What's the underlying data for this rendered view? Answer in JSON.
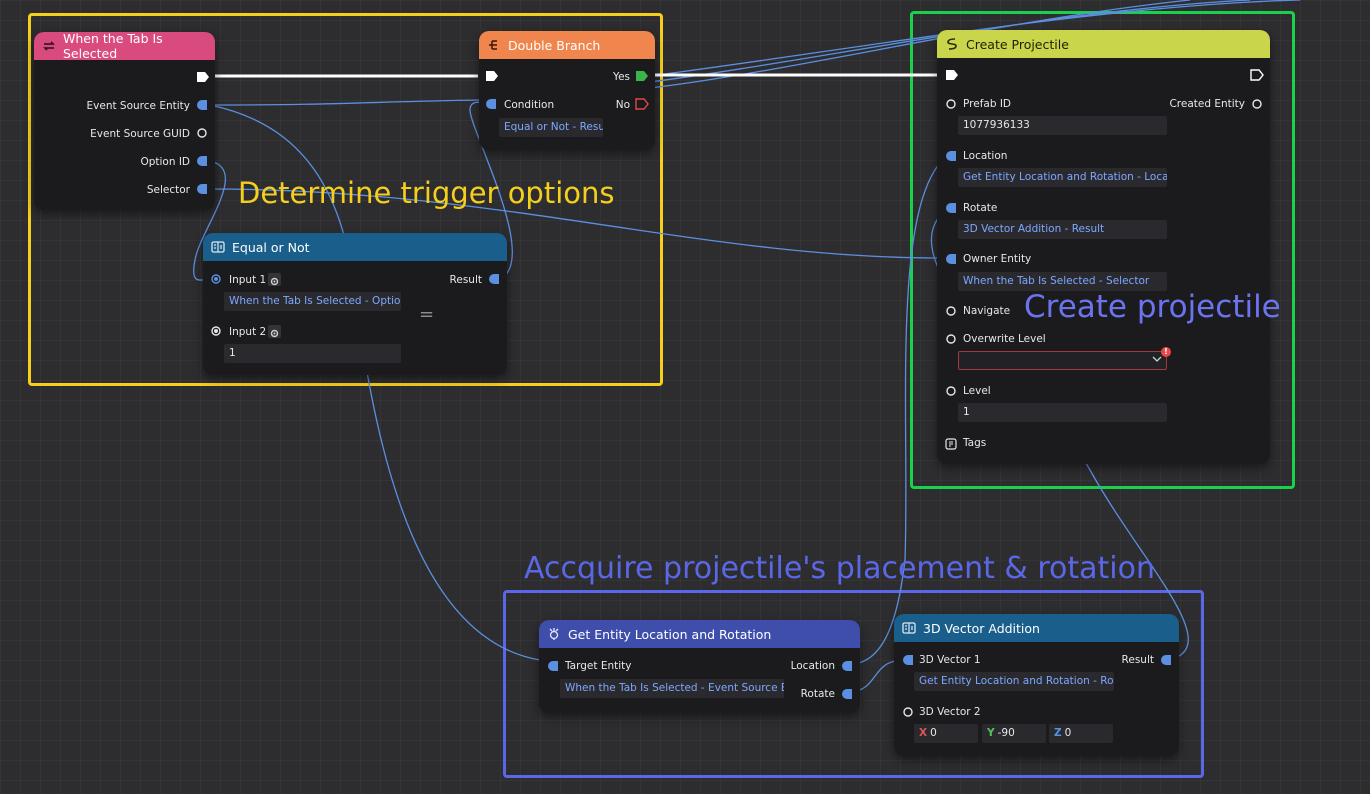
{
  "groups": {
    "trigger": "Determine trigger options",
    "create": "Create projectile",
    "placement": "Accquire projectile's placement & rotation"
  },
  "nodes": {
    "tab_selected": {
      "title": "When the Tab Is Selected",
      "outputs": [
        "Event Source Entity",
        "Event Source GUID",
        "Option ID",
        "Selector"
      ]
    },
    "double_branch": {
      "title": "Double Branch",
      "yes": "Yes",
      "no": "No",
      "condition": "Condition",
      "condition_value": "Equal or Not - Result"
    },
    "equal_or_not": {
      "title": "Equal or Not",
      "input1": "Input 1",
      "input1_value": "When the Tab Is Selected - Option ID",
      "input2": "Input 2",
      "input2_value": "1",
      "result": "Result",
      "operator": "="
    },
    "create_projectile": {
      "title": "Create Projectile",
      "prefab_id": "Prefab ID",
      "prefab_value": "1077936133",
      "created_entity": "Created Entity",
      "location": "Location",
      "location_value": "Get Entity Location and Rotation - Location",
      "rotate": "Rotate",
      "rotate_value": "3D Vector Addition - Result",
      "owner": "Owner Entity",
      "owner_value": "When the Tab Is Selected - Selector",
      "navigate": "Navigate",
      "overwrite_level": "Overwrite Level",
      "warning": "!",
      "level": "Level",
      "level_value": "1",
      "tags": "Tags"
    },
    "get_location": {
      "title": "Get Entity Location and Rotation",
      "target": "Target Entity",
      "target_value": "When the Tab Is Selected - Event Source Entity",
      "location": "Location",
      "rotate": "Rotate"
    },
    "vector_add": {
      "title": "3D Vector Addition",
      "v1": "3D Vector 1",
      "v1_value": "Get Entity Location and Rotation - Rotate",
      "v2": "3D Vector 2",
      "result": "Result",
      "x_label": "X",
      "x_value": "0",
      "y_label": "Y",
      "y_value": "-90",
      "z_label": "Z",
      "z_value": "0"
    }
  },
  "colors": {
    "header_tab_selected": "#d94b7e",
    "header_double_branch": "#f0854d",
    "header_equal_or_not": "#1a5f8c",
    "header_create_projectile": "#c9d54a",
    "header_get_location": "#3e4eaa",
    "header_vector_add": "#1a5f8c",
    "data_pin": "#5b8fe0",
    "yes_pin": "#39b54a",
    "no_pin": "#e04848",
    "wire": "#5b8fe0",
    "exec_wire": "#ffffff"
  }
}
